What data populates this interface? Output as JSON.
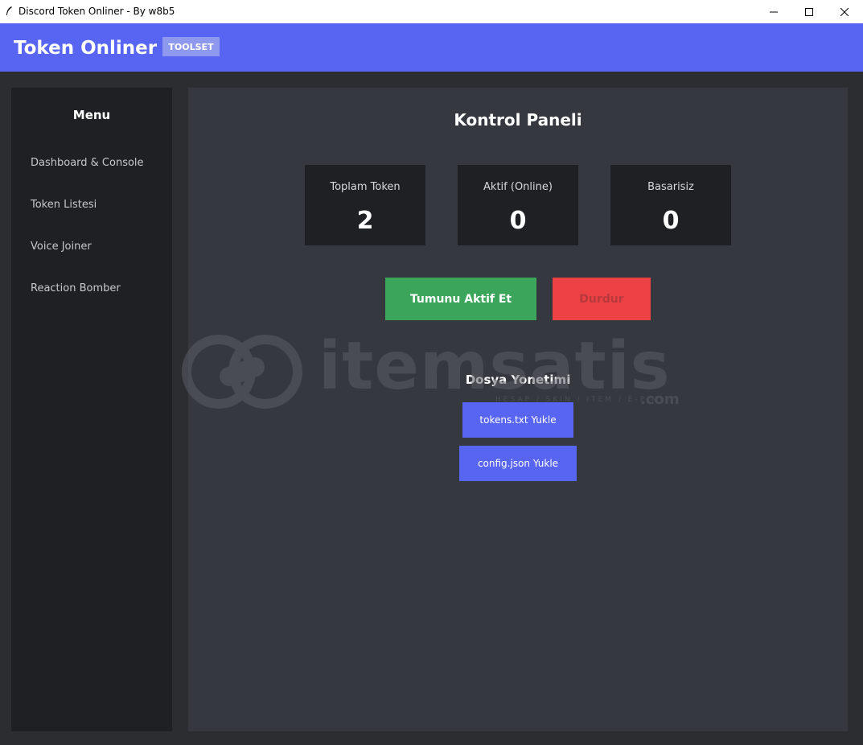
{
  "window": {
    "title": "Discord Token Onliner - By w8b5"
  },
  "header": {
    "app_title": "Token Onliner",
    "badge": "TOOLSET",
    "accent_color": "#5865f2"
  },
  "sidebar": {
    "title": "Menu",
    "items": [
      {
        "label": "Dashboard & Console"
      },
      {
        "label": "Token Listesi"
      },
      {
        "label": "Voice Joiner"
      },
      {
        "label": "Reaction Bomber"
      }
    ]
  },
  "main": {
    "title": "Kontrol Paneli",
    "stats": [
      {
        "label": "Toplam Token",
        "value": "2"
      },
      {
        "label": "Aktif (Online)",
        "value": "0"
      },
      {
        "label": "Basarisiz",
        "value": "0"
      }
    ],
    "actions": {
      "activate_label": "Tumunu Aktif Et",
      "activate_color": "#3ba55c",
      "stop_label": "Durdur",
      "stop_color": "#ed4245"
    },
    "files": {
      "title": "Dosya Yonetimi",
      "tokens_label": "tokens.txt Yukle",
      "config_label": "config.json Yukle"
    }
  },
  "watermark": {
    "text": "itemsatis",
    "sub": "HESAP / SKIN / ITEM / E-PIN",
    "suffix": ".com"
  }
}
